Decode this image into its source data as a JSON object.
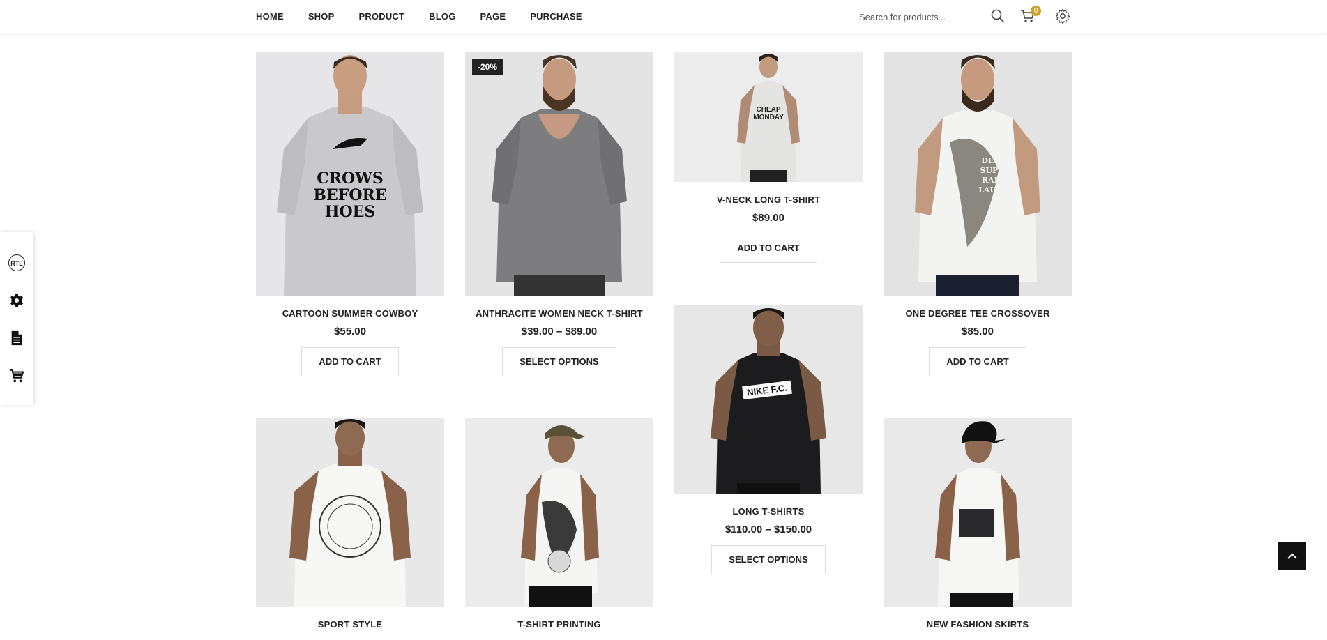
{
  "nav": {
    "items": [
      {
        "label": "HOME"
      },
      {
        "label": "SHOP"
      },
      {
        "label": "PRODUCT"
      },
      {
        "label": "BLOG"
      },
      {
        "label": "PAGE"
      },
      {
        "label": "PURCHASE"
      }
    ]
  },
  "search": {
    "placeholder": "Search for products..."
  },
  "cart": {
    "count": "0"
  },
  "sidebar": {
    "rtl_label": "RTL"
  },
  "products": [
    {
      "name": "CARTOON SUMMER COWBOY",
      "price": "$55.00",
      "button": "ADD TO CART"
    },
    {
      "name": "ANTHRACITE WOMEN NECK T-SHIRT",
      "price": "$39.00 – $89.00",
      "button": "SELECT OPTIONS",
      "badge": "-20%"
    },
    {
      "name": "V-NECK LONG T-SHIRT",
      "price": "$89.00",
      "button": "ADD TO CART"
    },
    {
      "name": "ONE DEGREE TEE CROSSOVER",
      "price": "$85.00",
      "button": "ADD TO CART"
    },
    {
      "name": "LONG T-SHIRTS",
      "price": "$110.00 – $150.00",
      "button": "SELECT OPTIONS"
    },
    {
      "name": "SPORT STYLE"
    },
    {
      "name": "T-SHIRT PRINTING"
    },
    {
      "name": "NEW FASHION SKIRTS"
    }
  ],
  "shirt_prints": {
    "p1": [
      "CROWS",
      "BEFORE",
      "HOES"
    ],
    "p3": [
      "CHEAP",
      "MONDAY"
    ],
    "p4": [
      "DENIM",
      "SUPPLY",
      "RALPH LAUREN"
    ],
    "p5": [
      "NIKE F.C."
    ]
  },
  "icons": [
    "search-icon",
    "cart-icon",
    "gear-icon",
    "settings-gear-icon",
    "document-icon",
    "cart-icon",
    "chevron-up-icon"
  ],
  "colors": {
    "accent": "#c9a227",
    "dark": "#222222",
    "image_bg": "#e9e9ea"
  }
}
